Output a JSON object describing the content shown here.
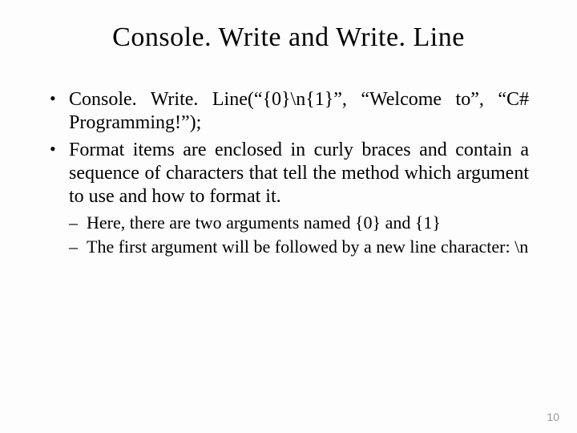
{
  "title": "Console. Write and Write. Line",
  "bullets": [
    "Console. Write. Line(“{0}\\n{1}”, “Welcome to”, “C# Programming!”);",
    "Format items are enclosed in curly braces and contain a sequence of characters that tell the method which argument to use and how to format it."
  ],
  "subbullets": [
    "Here, there are two arguments named {0} and {1}",
    "The first argument will be followed by a new line character: \\n"
  ],
  "page_number": "10"
}
